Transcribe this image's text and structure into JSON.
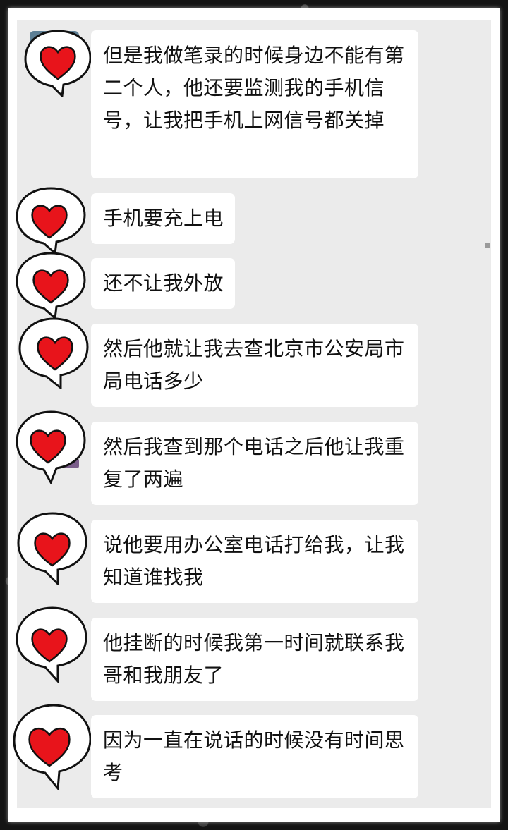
{
  "colors": {
    "frame": "#151515",
    "paper": "#ffffff",
    "chat_background": "#ebebeb",
    "bubble": "#ffffff",
    "heart": "#e8141b",
    "text": "#111111"
  },
  "avatar_icon": "heart-speech-bubble-icon",
  "messages": [
    {
      "text": "但是我做笔录的时候身边不能有第二个人，他还要监测我的手机信号，让我把手机上网信号都关掉"
    },
    {
      "text": "手机要充上电"
    },
    {
      "text": "还不让我外放"
    },
    {
      "text": "然后他就让我去查北京市公安局市局电话多少"
    },
    {
      "text": "然后我查到那个电话之后他让我重复了两遍"
    },
    {
      "text": "说他要用办公室电话打给我，让我知道谁找我"
    },
    {
      "text": "他挂断的时候我第一时间就联系我哥和我朋友了"
    },
    {
      "text": "因为一直在说话的时候没有时间思考"
    }
  ]
}
